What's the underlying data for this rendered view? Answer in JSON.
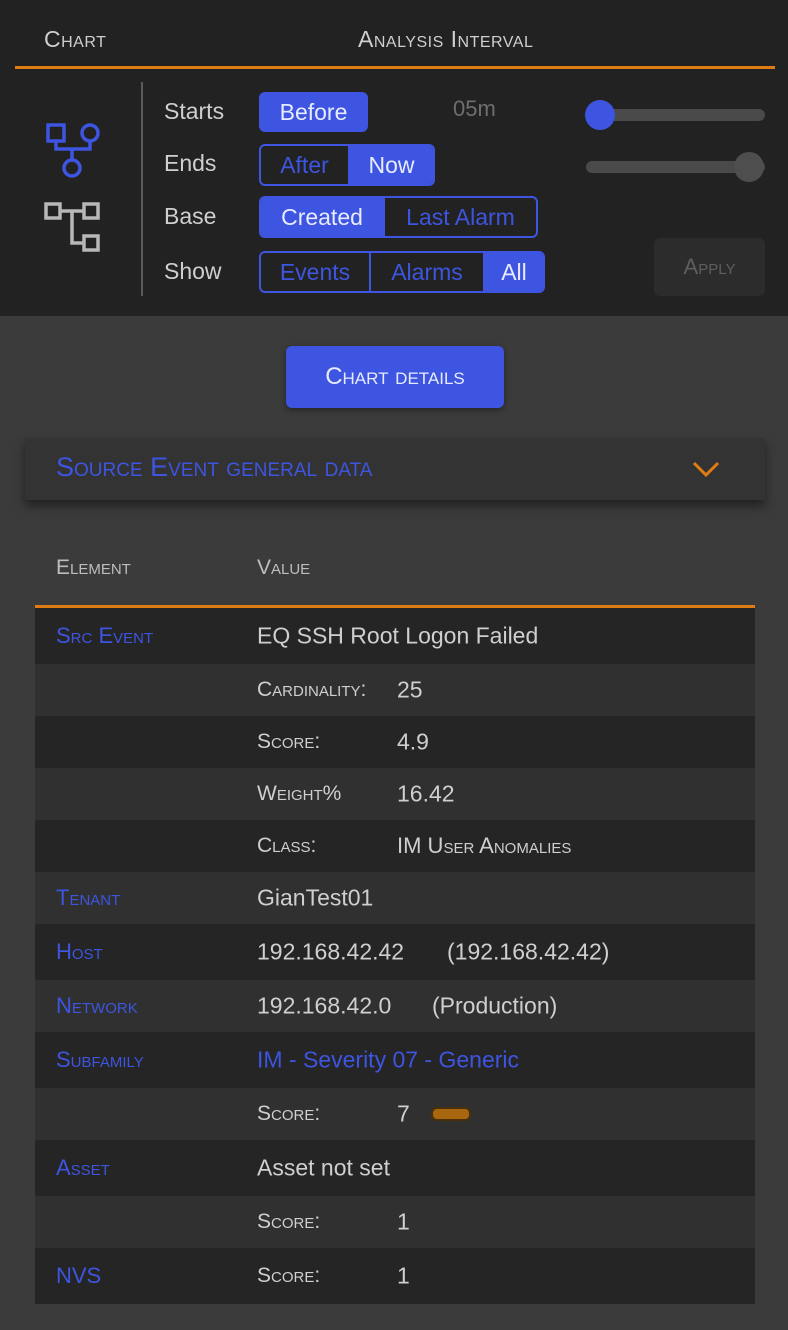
{
  "header": {
    "chart_label": "Chart",
    "interval_label": "Analysis Interval"
  },
  "controls": {
    "starts_label": "Starts",
    "starts_value": "Before",
    "ends_label": "Ends",
    "ends_options": [
      "After",
      "Now"
    ],
    "ends_active": "Now",
    "base_label": "Base",
    "base_options": [
      "Created",
      "Last Alarm"
    ],
    "base_active": "Created",
    "show_label": "Show",
    "show_options": [
      "Events",
      "Alarms",
      "All"
    ],
    "show_active": "All",
    "interval_value": "05m",
    "slider_start_level": 0.0,
    "slider_end_level": 1.0,
    "apply_label": "Apply"
  },
  "details_button": "Chart details",
  "accordion": {
    "title": "Source Event general data"
  },
  "table": {
    "headers": [
      "Element",
      "Value"
    ],
    "rows": [
      {
        "element": "Src Event",
        "value": "EQ SSH Root Logon Failed"
      },
      {
        "sublabel": "Cardinality:",
        "subvalue": "25"
      },
      {
        "sublabel": "Score:",
        "subvalue": "4.9"
      },
      {
        "sublabel": "Weight%",
        "subvalue": "16.42"
      },
      {
        "sublabel": "Class:",
        "subvalue": "IM User Anomalies"
      },
      {
        "element": "Tenant",
        "value": "GianTest01"
      },
      {
        "element": "Host",
        "value": "192.168.42.42",
        "value2": "(192.168.42.42)"
      },
      {
        "element": "Network",
        "value": "192.168.42.0",
        "value2": "(Production)"
      },
      {
        "element": "Subfamily",
        "value": "IM - Severity 07 - Generic"
      },
      {
        "sublabel": "Score:",
        "subvalue": "7"
      },
      {
        "element": "Asset",
        "value": "Asset not set"
      },
      {
        "sublabel": "Score:",
        "subvalue": "1"
      },
      {
        "element": "NVS",
        "sublabel": "Score:",
        "subvalue": "1"
      }
    ]
  },
  "colors": {
    "accent_blue": "#3d55e0",
    "accent_orange": "#e07d12",
    "score_pill": "#a8660f"
  },
  "icons": [
    "graph-node-icon",
    "tree-structure-icon",
    "chevron-down-icon"
  ]
}
